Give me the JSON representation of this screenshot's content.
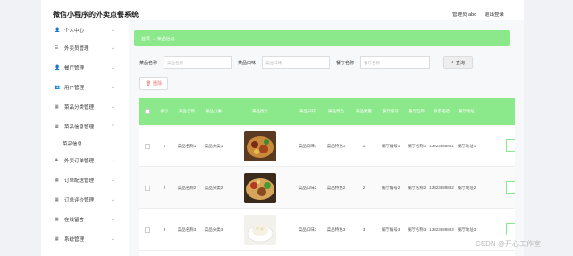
{
  "header": {
    "title": "微信小程序的外卖点餐系统",
    "admin": "管理员 abo",
    "logout": "退出登录"
  },
  "sidebar": {
    "items": [
      {
        "icon": "person-icon",
        "glyph": "👤",
        "label": "个人中心"
      },
      {
        "icon": "list-icon",
        "glyph": "☰",
        "label": "外卖员管理"
      },
      {
        "icon": "person-icon",
        "glyph": "👤",
        "label": "餐厅管理"
      },
      {
        "icon": "user-icon",
        "glyph": "👥",
        "label": "用户管理"
      },
      {
        "icon": "grid-icon",
        "glyph": "▦",
        "label": "菜品分类管理"
      },
      {
        "icon": "grid-icon",
        "glyph": "▦",
        "label": "菜品信息管理"
      },
      {
        "icon": "plus-icon",
        "glyph": "✚",
        "label": "外卖订单管理"
      },
      {
        "icon": "grid-icon",
        "glyph": "▦",
        "label": "订单配送管理"
      },
      {
        "icon": "grid-icon",
        "glyph": "▦",
        "label": "订单评价管理"
      },
      {
        "icon": "grid-icon",
        "glyph": "▦",
        "label": "在线留言"
      },
      {
        "icon": "grid-icon",
        "glyph": "▦",
        "label": "系统管理"
      }
    ],
    "sub_item": "菜品信息"
  },
  "breadcrumb": {
    "home": "首页",
    "arrow": "→",
    "current": "菜品信息"
  },
  "search": {
    "name_label": "菜品名称",
    "name_placeholder": "菜品名称",
    "taste_label": "菜品口味",
    "taste_placeholder": "菜品口味",
    "shop_label": "餐厅名称",
    "shop_placeholder": "餐厅名称",
    "button": "查询"
  },
  "delete_button": "删除",
  "table": {
    "headers": [
      "索引",
      "菜品名称",
      "菜品分类",
      "菜品图片",
      "菜品口味",
      "菜品特色",
      "菜品数量",
      "餐厅编号",
      "餐厅名称",
      "联系电话",
      "餐厅地址"
    ],
    "rows": [
      {
        "index": "1",
        "name": "菜品名称1",
        "category": "菜品分类1",
        "taste": "菜品口味1",
        "feature": "菜品特色1",
        "qty": "1",
        "shop_no": "餐厅编号1",
        "shop_name": "餐厅名称1",
        "phone": "13823888881",
        "address": "餐厅地址1"
      },
      {
        "index": "2",
        "name": "菜品名称2",
        "category": "菜品分类2",
        "taste": "菜品口味2",
        "feature": "菜品特色2",
        "qty": "2",
        "shop_no": "餐厅编号2",
        "shop_name": "餐厅名称2",
        "phone": "13823888882",
        "address": "餐厅地址2"
      },
      {
        "index": "3",
        "name": "菜品名称3",
        "category": "菜品分类3",
        "taste": "菜品口味3",
        "feature": "菜品特色3",
        "qty": "3",
        "shop_no": "餐厅编号3",
        "shop_name": "餐厅名称3",
        "phone": "13823888883",
        "address": "餐厅地址3"
      }
    ]
  },
  "watermark": "CSDN @开心工作室",
  "colors": {
    "accent": "#8be88b",
    "danger": "#e57373"
  }
}
